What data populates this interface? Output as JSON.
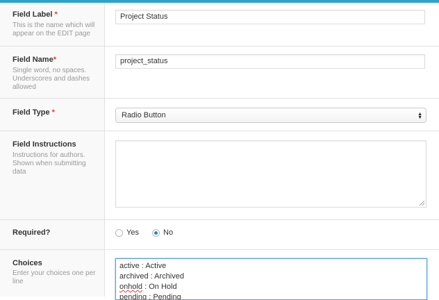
{
  "fields": {
    "label": {
      "title": "Field Label",
      "required_mark": "*",
      "description": "This is the name which will appear on the EDIT page",
      "value": "Project Status"
    },
    "name": {
      "title": "Field Name",
      "required_mark": "*",
      "description": "Single word, no spaces. Underscores and dashes allowed",
      "value": "project_status"
    },
    "type": {
      "title": "Field Type",
      "required_mark": "*",
      "selected": "Radio Button"
    },
    "instructions": {
      "title": "Field Instructions",
      "description": "Instructions for authors. Shown when submitting data",
      "value": ""
    },
    "required": {
      "title": "Required?",
      "options": [
        {
          "label": "Yes",
          "checked": false
        },
        {
          "label": "No",
          "checked": true
        }
      ]
    },
    "choices": {
      "title": "Choices",
      "description": "Enter your choices one per line",
      "lines": [
        {
          "key": "active",
          "sep": " : ",
          "label": "Active"
        },
        {
          "key": "archived",
          "sep": " : ",
          "label": "Archived"
        },
        {
          "key": "onhold",
          "sep": " : ",
          "label": "On Hold"
        },
        {
          "key": "pending",
          "sep": " : ",
          "label": "Pending"
        }
      ]
    }
  },
  "colors": {
    "accent": "#2ea2cc",
    "required": "#dd3d36",
    "radio_checked": "#1e8cbe",
    "focus_border": "#5b9dd9"
  }
}
